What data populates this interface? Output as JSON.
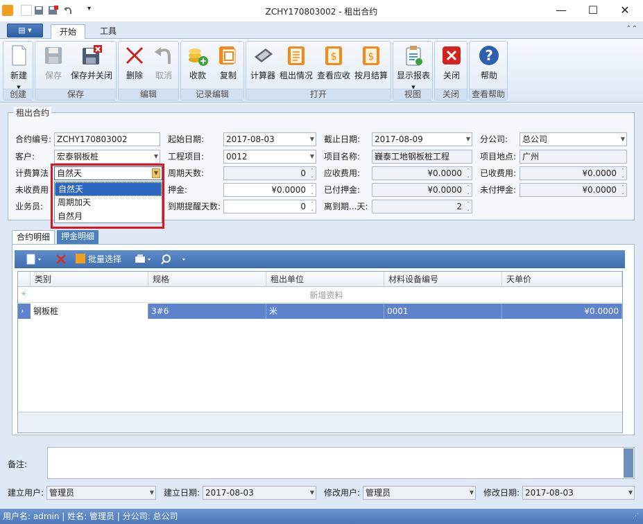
{
  "window": {
    "title": "ZCHY170803002 - 租出合约"
  },
  "ribbon": {
    "app_button": "",
    "tabs": [
      "开始",
      "工具"
    ],
    "groups": [
      {
        "label": "创建",
        "buttons": [
          {
            "label": "新建",
            "enabled": true
          }
        ]
      },
      {
        "label": "保存",
        "buttons": [
          {
            "label": "保存",
            "enabled": false
          },
          {
            "label": "保存并关闭",
            "enabled": true
          }
        ]
      },
      {
        "label": "编辑",
        "buttons": [
          {
            "label": "删除",
            "enabled": true
          },
          {
            "label": "取消",
            "enabled": false
          }
        ]
      },
      {
        "label": "记录编辑",
        "buttons": [
          {
            "label": "收款",
            "enabled": true
          },
          {
            "label": "复制",
            "enabled": true
          }
        ]
      },
      {
        "label": "打开",
        "buttons": [
          {
            "label": "计算器",
            "enabled": true
          },
          {
            "label": "租出情况",
            "enabled": true
          },
          {
            "label": "查看应收",
            "enabled": true
          },
          {
            "label": "按月结算",
            "enabled": true
          }
        ]
      },
      {
        "label": "视图",
        "buttons": [
          {
            "label": "显示报表",
            "enabled": true
          }
        ]
      },
      {
        "label": "关闭",
        "buttons": [
          {
            "label": "关闭",
            "enabled": true
          }
        ]
      },
      {
        "label": "查看帮助",
        "buttons": [
          {
            "label": "帮助",
            "enabled": true
          }
        ]
      }
    ]
  },
  "contract": {
    "legend": "租出合约",
    "fields": {
      "contract_no": {
        "label": "合约编号:",
        "value": "ZCHY170803002"
      },
      "start_date": {
        "label": "起始日期:",
        "value": "2017-08-03"
      },
      "end_date": {
        "label": "截止日期:",
        "value": "2017-08-09"
      },
      "branch": {
        "label": "分公司:",
        "value": "总公司"
      },
      "customer": {
        "label": "客户:",
        "value": "宏泰钢板桩"
      },
      "project": {
        "label": "工程项目:",
        "value": "0012"
      },
      "project_name": {
        "label": "项目名称:",
        "value": "巍泰工地钢板桩工程"
      },
      "project_site": {
        "label": "项目地点:",
        "value": "广州"
      },
      "billing_method": {
        "label": "计费算法",
        "value": "自然天"
      },
      "period_days": {
        "label": "周期天数:",
        "value": "0"
      },
      "receivable": {
        "label": "应收费用:",
        "value": "¥0.0000"
      },
      "received": {
        "label": "已收费用:",
        "value": "¥0.0000"
      },
      "unreceived": {
        "label": "未收费用"
      },
      "deposit": {
        "label": "押金:",
        "value": "¥0.0000"
      },
      "deposit_paid": {
        "label": "已付押金:",
        "value": "¥0.0000"
      },
      "deposit_unpaid": {
        "label": "未付押金:",
        "value": "¥0.0000"
      },
      "salesman": {
        "label": "业务员:"
      },
      "remind_days": {
        "label": "到期提醒天数:",
        "value": "0"
      },
      "days_to_expiry": {
        "label": "离到期...天:",
        "value": "2"
      }
    },
    "billing_options": [
      "自然天",
      "周期加天",
      "自然月"
    ]
  },
  "detail_tabs": [
    "合约明细",
    "押金明细"
  ],
  "grid": {
    "toolbar": {
      "batch_select": "批量选择"
    },
    "columns": [
      "类别",
      "规格",
      "租出单位",
      "材料设备编号",
      "天单价"
    ],
    "new_row_text": "新增资料",
    "rows": [
      {
        "category": "钢板桩",
        "spec": "3#6",
        "unit": "米",
        "code": "0001",
        "price": "¥0.0000"
      }
    ]
  },
  "remark": {
    "label": "备注:"
  },
  "footer": {
    "created_by": {
      "label": "建立用户:",
      "value": "管理员"
    },
    "created_date": {
      "label": "建立日期:",
      "value": "2017-08-03"
    },
    "modified_by": {
      "label": "修改用户:",
      "value": "管理员"
    },
    "modified_date": {
      "label": "修改日期:",
      "value": "2017-08-03"
    }
  },
  "status": {
    "text": "用户名: admin | 姓名: 管理员 | 分公司: 总公司"
  },
  "colors": {
    "accent": "#4a7fc0",
    "selection": "#5f82cc",
    "highlight_border": "#e0141e"
  }
}
